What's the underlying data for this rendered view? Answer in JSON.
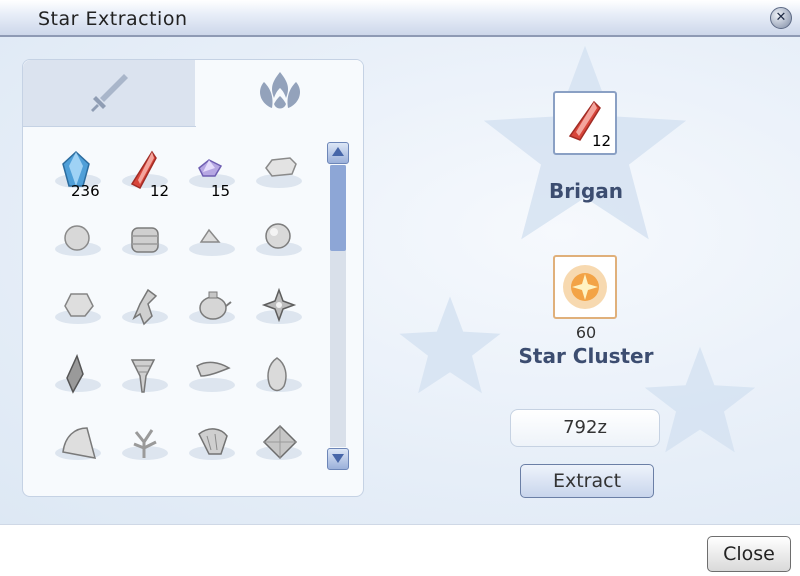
{
  "window": {
    "title": "Star Extraction"
  },
  "tabs": [
    {
      "icon": "sword-icon"
    },
    {
      "icon": "flame-icon"
    }
  ],
  "items": [
    {
      "icon": "blue-crystal-icon",
      "count": "236"
    },
    {
      "icon": "red-crystal-icon",
      "count": "12"
    },
    {
      "icon": "purple-gem-icon",
      "count": "15"
    },
    {
      "icon": "bone-icon",
      "count": ""
    },
    {
      "icon": "stone-icon",
      "count": ""
    },
    {
      "icon": "basket-icon",
      "count": ""
    },
    {
      "icon": "pebble-icon",
      "count": ""
    },
    {
      "icon": "orb-icon",
      "count": ""
    },
    {
      "icon": "rock-icon",
      "count": ""
    },
    {
      "icon": "figure-icon",
      "count": ""
    },
    {
      "icon": "pot-icon",
      "count": ""
    },
    {
      "icon": "shuriken-icon",
      "count": ""
    },
    {
      "icon": "shard-icon",
      "count": ""
    },
    {
      "icon": "drill-icon",
      "count": ""
    },
    {
      "icon": "fish-icon",
      "count": ""
    },
    {
      "icon": "bulb-icon",
      "count": ""
    },
    {
      "icon": "shell-icon",
      "count": ""
    },
    {
      "icon": "coral-icon",
      "count": ""
    },
    {
      "icon": "claw-icon",
      "count": ""
    },
    {
      "icon": "diamond-icon",
      "count": ""
    }
  ],
  "source": {
    "icon": "red-crystal-icon",
    "count": "12",
    "name": "Brigan"
  },
  "result": {
    "icon": "star-cluster-icon",
    "count": "60",
    "name": "Star Cluster"
  },
  "cost": "792z",
  "buttons": {
    "extract": "Extract",
    "close": "Close"
  },
  "colors": {
    "accent": "#3c4d70",
    "title_bar": "#cdd7ea",
    "scroll_thumb": "#8da6d6"
  }
}
